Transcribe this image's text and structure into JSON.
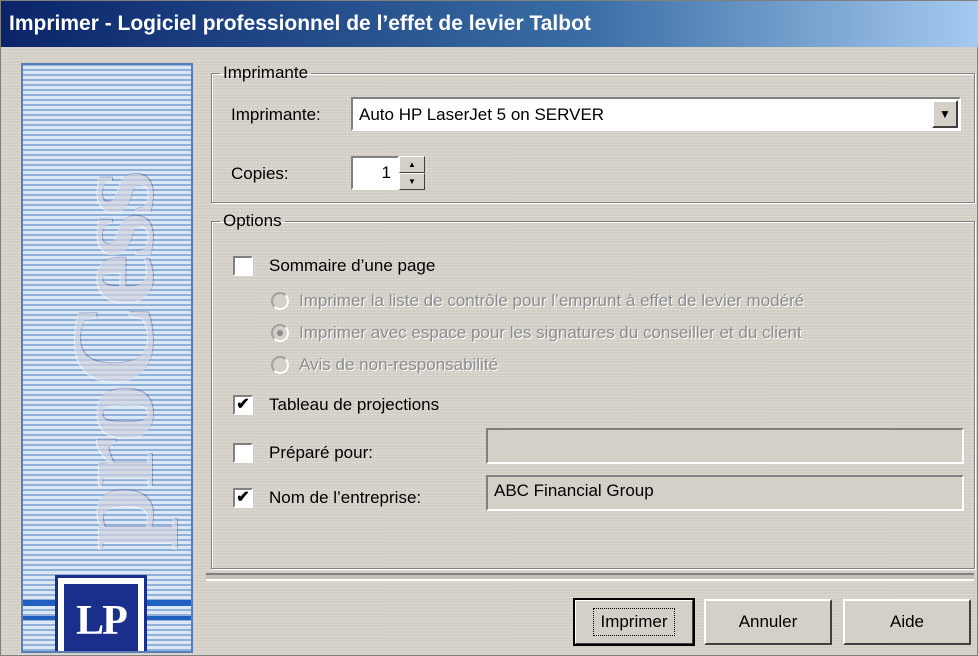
{
  "window": {
    "title": "Imprimer - Logiciel professionnel de l’effet de levier Talbot"
  },
  "banner": {
    "word": "proCess",
    "logo_text": "LP"
  },
  "printer_group": {
    "legend": "Imprimante",
    "printer_label": "Imprimante:",
    "printer_value": "Auto HP LaserJet 5 on SERVER",
    "copies_label": "Copies:",
    "copies_value": "1"
  },
  "options_group": {
    "legend": "Options",
    "summary_checkbox": {
      "label": "Sommaire d’une page",
      "checked": false
    },
    "radios": [
      {
        "label": "Imprimer la liste de contrôle pour l’emprunt à effet de levier modéré",
        "selected": false,
        "enabled": false
      },
      {
        "label": "Imprimer avec espace pour les signatures du conseiller et du client",
        "selected": true,
        "enabled": false
      },
      {
        "label": "Avis de non-responsabilité",
        "selected": false,
        "enabled": false
      }
    ],
    "projections_checkbox": {
      "label": "Tableau de projections",
      "checked": true,
      "mark": "✔"
    },
    "prepared_for": {
      "label": "Préparé pour:",
      "checked": false,
      "value": ""
    },
    "company_name": {
      "label": "Nom de l’entreprise:",
      "checked": true,
      "value": "ABC Financial Group",
      "mark": "✔"
    }
  },
  "buttons": {
    "print": "Imprimer",
    "cancel": "Annuler",
    "help": "Aide"
  },
  "icons": {
    "dropdown": "▼",
    "spin_up": "▲",
    "spin_down": "▼"
  }
}
